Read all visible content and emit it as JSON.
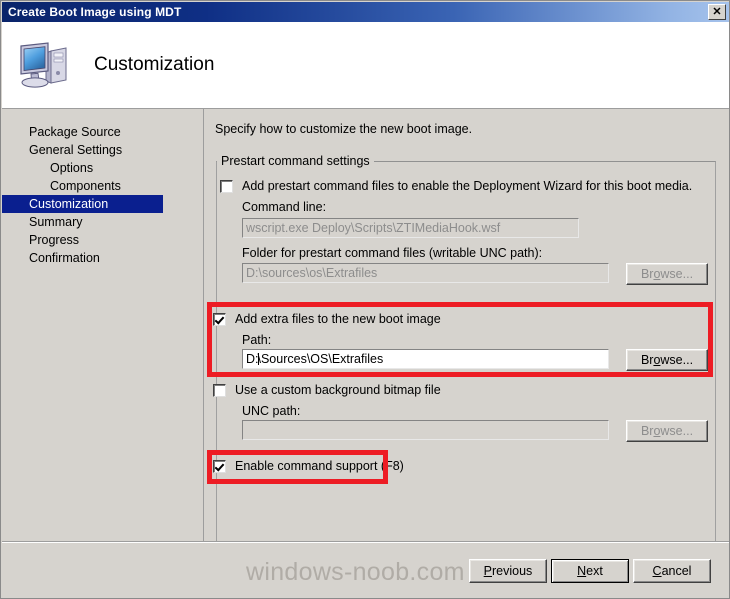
{
  "window": {
    "title": "Create Boot Image using MDT",
    "close_label": "✕",
    "close_icon": "close-icon"
  },
  "header": {
    "title": "Customization",
    "icon": "computer-icon"
  },
  "sidebar": {
    "items": [
      {
        "label": "Package Source",
        "indent": false,
        "selected": false
      },
      {
        "label": "General Settings",
        "indent": false,
        "selected": false
      },
      {
        "label": "Options",
        "indent": true,
        "selected": false
      },
      {
        "label": "Components",
        "indent": true,
        "selected": false
      },
      {
        "label": "Customization",
        "indent": false,
        "selected": true
      },
      {
        "label": "Summary",
        "indent": false,
        "selected": false
      },
      {
        "label": "Progress",
        "indent": false,
        "selected": false
      },
      {
        "label": "Confirmation",
        "indent": false,
        "selected": false
      }
    ]
  },
  "main": {
    "intro": "Specify how to customize the new boot image.",
    "groupbox_legend": "Prestart command settings",
    "prestart": {
      "checkbox_label": "Add prestart command files to enable the Deployment Wizard for this boot media.",
      "checked": false,
      "command_line_label": "Command line:",
      "command_line_value": "wscript.exe Deploy\\Scripts\\ZTIMediaHook.wsf",
      "folder_label": "Folder for prestart command files (writable UNC path):",
      "folder_value": "D:\\sources\\os\\Extrafiles",
      "browse_label": "Browse...",
      "browse_accel": "o"
    },
    "extra_files": {
      "checkbox_label": "Add extra files to the new boot image",
      "checked": true,
      "path_label": "Path:",
      "path_value_before_caret": "D:",
      "path_value_after_caret": "\\Sources\\OS\\Extrafiles",
      "browse_label": "Browse...",
      "browse_accel": "o",
      "highlighted": true
    },
    "background_bitmap": {
      "checkbox_label": "Use a custom background bitmap file",
      "checked": false,
      "unc_label": "UNC path:",
      "unc_value": "",
      "browse_label": "Browse...",
      "browse_accel": "o"
    },
    "command_support": {
      "checkbox_label": "Enable command support (F8)",
      "checked": true,
      "highlighted": true
    }
  },
  "footer": {
    "watermark": "windows-noob.com",
    "buttons": [
      {
        "label": "Previous",
        "accel": "P",
        "default": false
      },
      {
        "label": "Next",
        "accel": "N",
        "default": true
      },
      {
        "label": "Cancel",
        "accel": "C",
        "default": false
      }
    ]
  },
  "colors": {
    "title_bar_start": "#0a246a",
    "title_bar_end": "#a6c3ec",
    "dialog_face": "#d6d3ce",
    "selection": "#0a1f8f",
    "annotation_red": "#ed1c24",
    "watermark_gray": "#b0aca6"
  }
}
